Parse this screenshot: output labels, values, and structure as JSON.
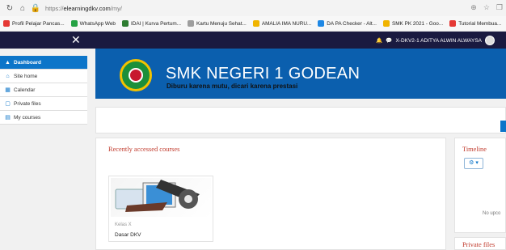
{
  "browser": {
    "url_prefix": "https://",
    "url_host": "elearningdkv.com",
    "url_path": "/my/"
  },
  "bookmarks": [
    {
      "label": "Profil Pelajar Pancas...",
      "color": "#e53935"
    },
    {
      "label": "WhatsApp Web",
      "color": "#25a244"
    },
    {
      "label": "IDAI | Kurva Pertum...",
      "color": "#2e7d32"
    },
    {
      "label": "Kartu Menuju Sehat...",
      "color": "#9e9e9e"
    },
    {
      "label": "AMALIA IMA NURU...",
      "color": "#f0b400"
    },
    {
      "label": "DA PA Checker - Alt...",
      "color": "#1e88e5"
    },
    {
      "label": "SMK PK 2021 - Goo...",
      "color": "#f0b400"
    },
    {
      "label": "Tutorial Membua...",
      "color": "#e53935"
    }
  ],
  "navbar": {
    "close": "✕",
    "user": "X-DKV2-1 ADITYA ALWIN ALWAYSA"
  },
  "sidebar": [
    {
      "label": "Dashboard",
      "icon": "▲"
    },
    {
      "label": "Site home",
      "icon": "⌂"
    },
    {
      "label": "Calendar",
      "icon": "▦"
    },
    {
      "label": "Private files",
      "icon": "▢"
    },
    {
      "label": "My courses",
      "icon": "▤"
    }
  ],
  "banner": {
    "title": "SMK NEGERI 1 GODEAN",
    "subtitle": "Diburu karena mutu, dicari karena prestasi"
  },
  "recent": {
    "title": "Recently accessed courses",
    "course_category": "Kelas X",
    "course_name": "Dasar DKV"
  },
  "timeline": {
    "title": "Timeline",
    "dropdown": "⚙ ▾",
    "empty_text": "No upco"
  },
  "private_files": {
    "title": "Private files"
  }
}
